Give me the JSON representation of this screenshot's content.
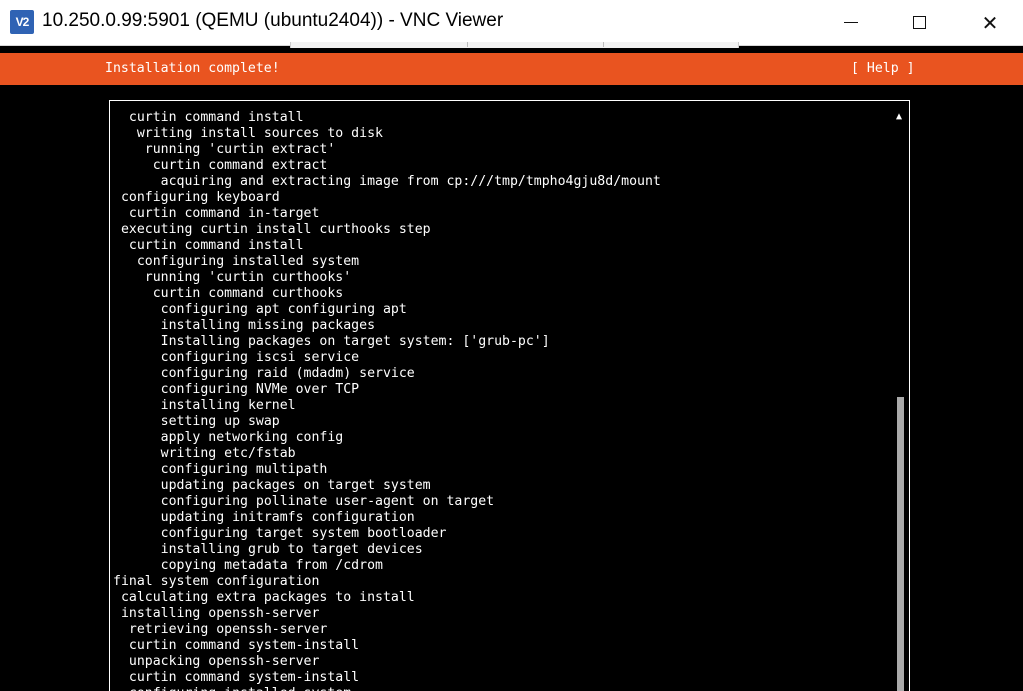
{
  "window": {
    "title": "10.250.0.99:5901 (QEMU (ubuntu2404)) - VNC Viewer",
    "icon_label": "V2",
    "controls": {
      "minimize": "minimize-icon",
      "maximize": "maximize-icon",
      "close": "close-icon",
      "close_glyph": "✕"
    }
  },
  "header": {
    "title": "Installation complete!",
    "help": "[ Help ]",
    "background_color": "#e95420"
  },
  "log": {
    "lines": [
      "  curtin command install",
      "   writing install sources to disk",
      "    running 'curtin extract'",
      "     curtin command extract",
      "      acquiring and extracting image from cp:///tmp/tmpho4gju8d/mount",
      " configuring keyboard",
      "  curtin command in-target",
      " executing curtin install curthooks step",
      "  curtin command install",
      "   configuring installed system",
      "    running 'curtin curthooks'",
      "     curtin command curthooks",
      "      configuring apt configuring apt",
      "      installing missing packages",
      "      Installing packages on target system: ['grub-pc']",
      "      configuring iscsi service",
      "      configuring raid (mdadm) service",
      "      configuring NVMe over TCP",
      "      installing kernel",
      "      setting up swap",
      "      apply networking config",
      "      writing etc/fstab",
      "      configuring multipath",
      "      updating packages on target system",
      "      configuring pollinate user-agent on target",
      "      updating initramfs configuration",
      "      configuring target system bootloader",
      "      installing grub to target devices",
      "      copying metadata from /cdrom",
      "final system configuration",
      " calculating extra packages to install",
      " installing openssh-server",
      "  retrieving openssh-server",
      "  curtin command system-install",
      "  unpacking openssh-server",
      "  curtin command system-install",
      "  configuring installed system"
    ],
    "scroll_up_glyph": "▲"
  }
}
